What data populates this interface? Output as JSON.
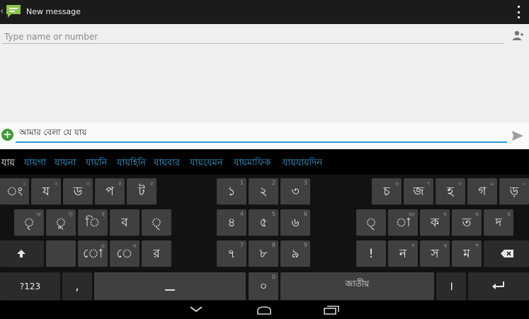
{
  "action_bar": {
    "title": "New message",
    "app_icon": "messaging-icon",
    "overflow_icon": "overflow-menu-icon"
  },
  "recipient": {
    "placeholder": "Type name or number",
    "value": "",
    "contact_icon": "person-icon"
  },
  "compose": {
    "attach_icon": "attach-plus-icon",
    "message_text": "আমার বেলা যে যায়",
    "send_icon": "send-icon"
  },
  "suggestions": [
    "যায়",
    "যায়গা",
    "যায়না",
    "যায়নি",
    "যায়হিনি",
    "যায়বার",
    "যায়যেমন",
    "যায়মাফিক",
    "যায়যায়দিন"
  ],
  "keyboard": {
    "row1_left": [
      {
        "label": "ং",
        "hint": "১"
      },
      {
        "label": "য",
        "hint": "২"
      },
      {
        "label": "ড",
        "hint": "৩"
      },
      {
        "label": "প",
        "hint": "৪"
      },
      {
        "label": "ট",
        "hint": "৫"
      }
    ],
    "row1_num": [
      {
        "label": "১",
        "hint": "1"
      },
      {
        "label": "২",
        "hint": "2"
      },
      {
        "label": "৩",
        "hint": "3"
      }
    ],
    "row1_right": [
      {
        "label": "চ",
        "hint": "৬"
      },
      {
        "label": "জ",
        "hint": "৭"
      },
      {
        "label": "হ",
        "hint": "৮"
      },
      {
        "label": "গ",
        "hint": "৯"
      },
      {
        "label": "ড়",
        "hint": "০"
      }
    ],
    "row2_left": [
      {
        "label": "ৃ",
        "hint": "ঋ"
      },
      {
        "label": "ু",
        "hint": "উ"
      },
      {
        "label": "ি",
        "hint": "ই"
      },
      {
        "label": "ব",
        "hint": ""
      },
      {
        "label": "্",
        "hint": ""
      }
    ],
    "row2_num": [
      {
        "label": "৪",
        "hint": "4"
      },
      {
        "label": "৫",
        "hint": "5"
      },
      {
        "label": "৬",
        "hint": "6"
      }
    ],
    "row2_right": [
      {
        "label": "্",
        "hint": ""
      },
      {
        "label": "া",
        "hint": "আ"
      },
      {
        "label": "ক",
        "hint": "খ"
      },
      {
        "label": "ত",
        "hint": "থ"
      },
      {
        "label": "দ",
        "hint": "ধ"
      }
    ],
    "row3_left": [
      {
        "label": "",
        "hint": ""
      },
      {
        "label": "ো",
        "hint": "ও"
      },
      {
        "label": "ে",
        "hint": "এ"
      },
      {
        "label": "র",
        "hint": ""
      }
    ],
    "row3_num": [
      {
        "label": "৭",
        "hint": "7"
      },
      {
        "label": "৮",
        "hint": "8"
      },
      {
        "label": "৯",
        "hint": "9"
      }
    ],
    "row3_right": [
      {
        "label": "!",
        "hint": ""
      },
      {
        "label": "ন",
        "hint": "ণ"
      },
      {
        "label": "স",
        "hint": "ষ"
      },
      {
        "label": "ম",
        "hint": "শ"
      }
    ],
    "shift_icon": "shift-icon",
    "backspace_icon": "backspace-icon",
    "symbols_label": "?123",
    "comma_label": ",",
    "zero_label": "০",
    "zero_hint": "0",
    "space_label": "জাতীয়",
    "period_label": "।",
    "enter_icon": "enter-icon"
  },
  "navbar": {
    "back_icon": "nav-back-icon",
    "home_icon": "nav-home-icon",
    "recent_icon": "nav-recent-icon"
  }
}
